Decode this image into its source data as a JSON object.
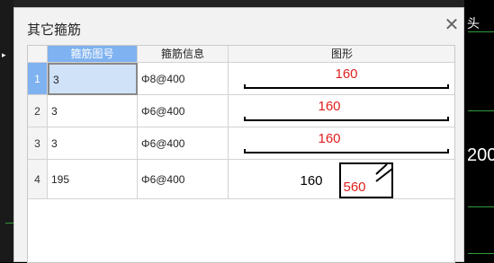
{
  "background": {
    "right_label": "头",
    "right_number": "200"
  },
  "dialog": {
    "title": "其它箍筋",
    "close_icon": "close-icon"
  },
  "table": {
    "columns": [
      "箍筋图号",
      "箍筋信息",
      "图形"
    ],
    "rows": [
      {
        "index": "1",
        "code": "3",
        "info": "Φ8@400",
        "shape_label": "160"
      },
      {
        "index": "2",
        "code": "3",
        "info": "Φ6@400",
        "shape_label": "160"
      },
      {
        "index": "3",
        "code": "3",
        "info": "Φ6@400",
        "shape_label": "160"
      },
      {
        "index": "4",
        "code": "195",
        "info": "Φ6@400",
        "shape_label_black": "160",
        "shape_label_red": "560"
      }
    ]
  },
  "colors": {
    "accent": "#7fb2f0",
    "selected_cell": "#cfe2f7",
    "shape_label": "#e02020"
  }
}
